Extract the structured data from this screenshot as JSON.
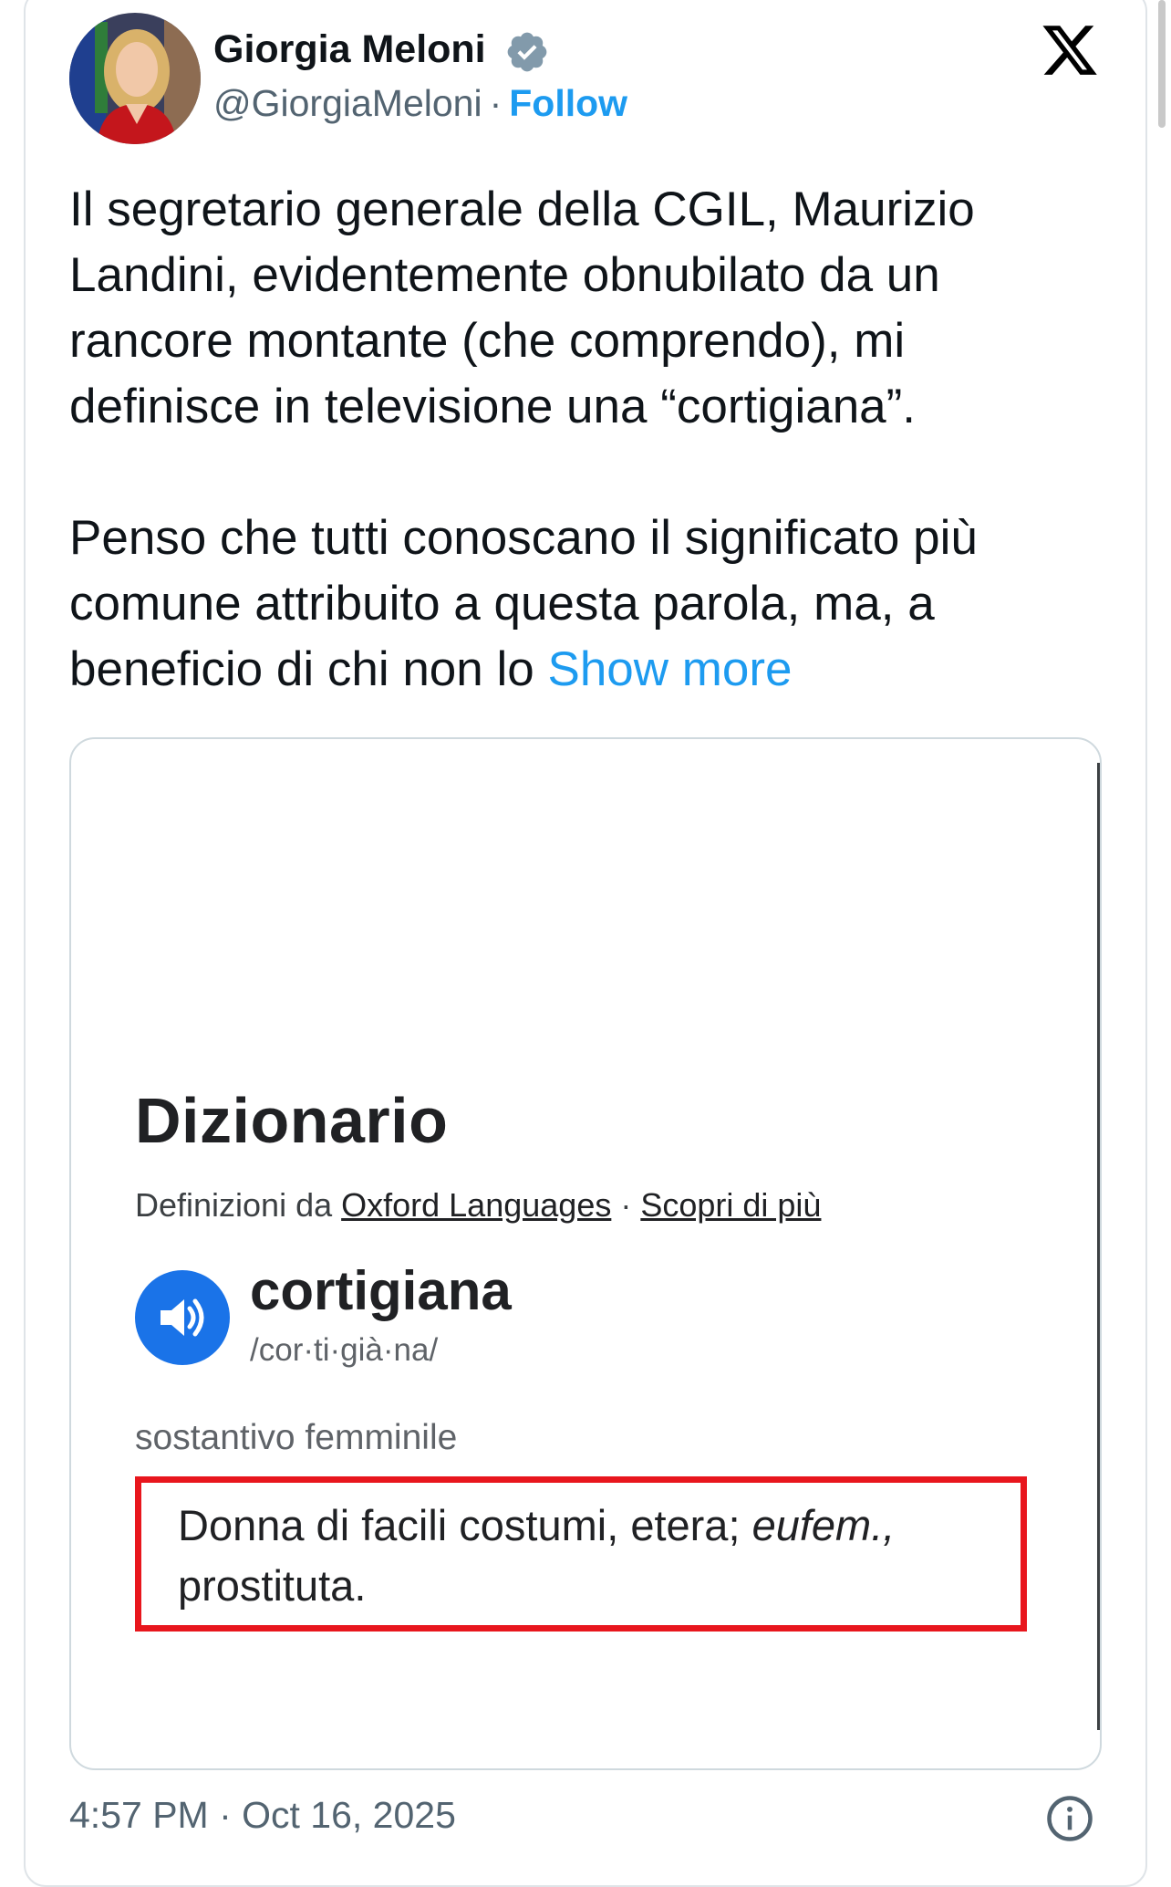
{
  "author": {
    "name": "Giorgia Meloni",
    "handle": "@GiorgiaMeloni",
    "separator": "·",
    "follow_label": "Follow",
    "verified_icon": "verified-badge-icon"
  },
  "tweet": {
    "text": "Il segretario generale della CGIL, Maurizio\nLandini, evidentemente obnubilato da un\nrancore montante (che comprendo), mi\ndefinisce in televisione una “cortigiana”.\n\nPenso che tutti conoscano il significato più\ncomune attribuito a questa parola, ma, a\nbeneficio di chi non lo ",
    "show_more_label": "Show more"
  },
  "media": {
    "title": "Dizionario",
    "source_prefix": "Definizioni da ",
    "source_link": "Oxford Languages",
    "source_sep": " · ",
    "learn_more": "Scopri di più",
    "word": "cortigiana",
    "phonetic": "/cor·ti·già·na/",
    "part_of_speech": "sostantivo femminile",
    "definition_main": "Donna di facili costumi, etera; ",
    "definition_abbrev": "eufem.,",
    "definition_end": "prostituta.",
    "highlight_color": "#e8161d",
    "speaker_icon": "speaker-icon"
  },
  "footer": {
    "timestamp": "4:57 PM · Oct 16, 2025",
    "info_icon": "info-icon"
  },
  "colors": {
    "accent": "#1d9bf0",
    "text": "#0f1419",
    "muted": "#536471"
  }
}
